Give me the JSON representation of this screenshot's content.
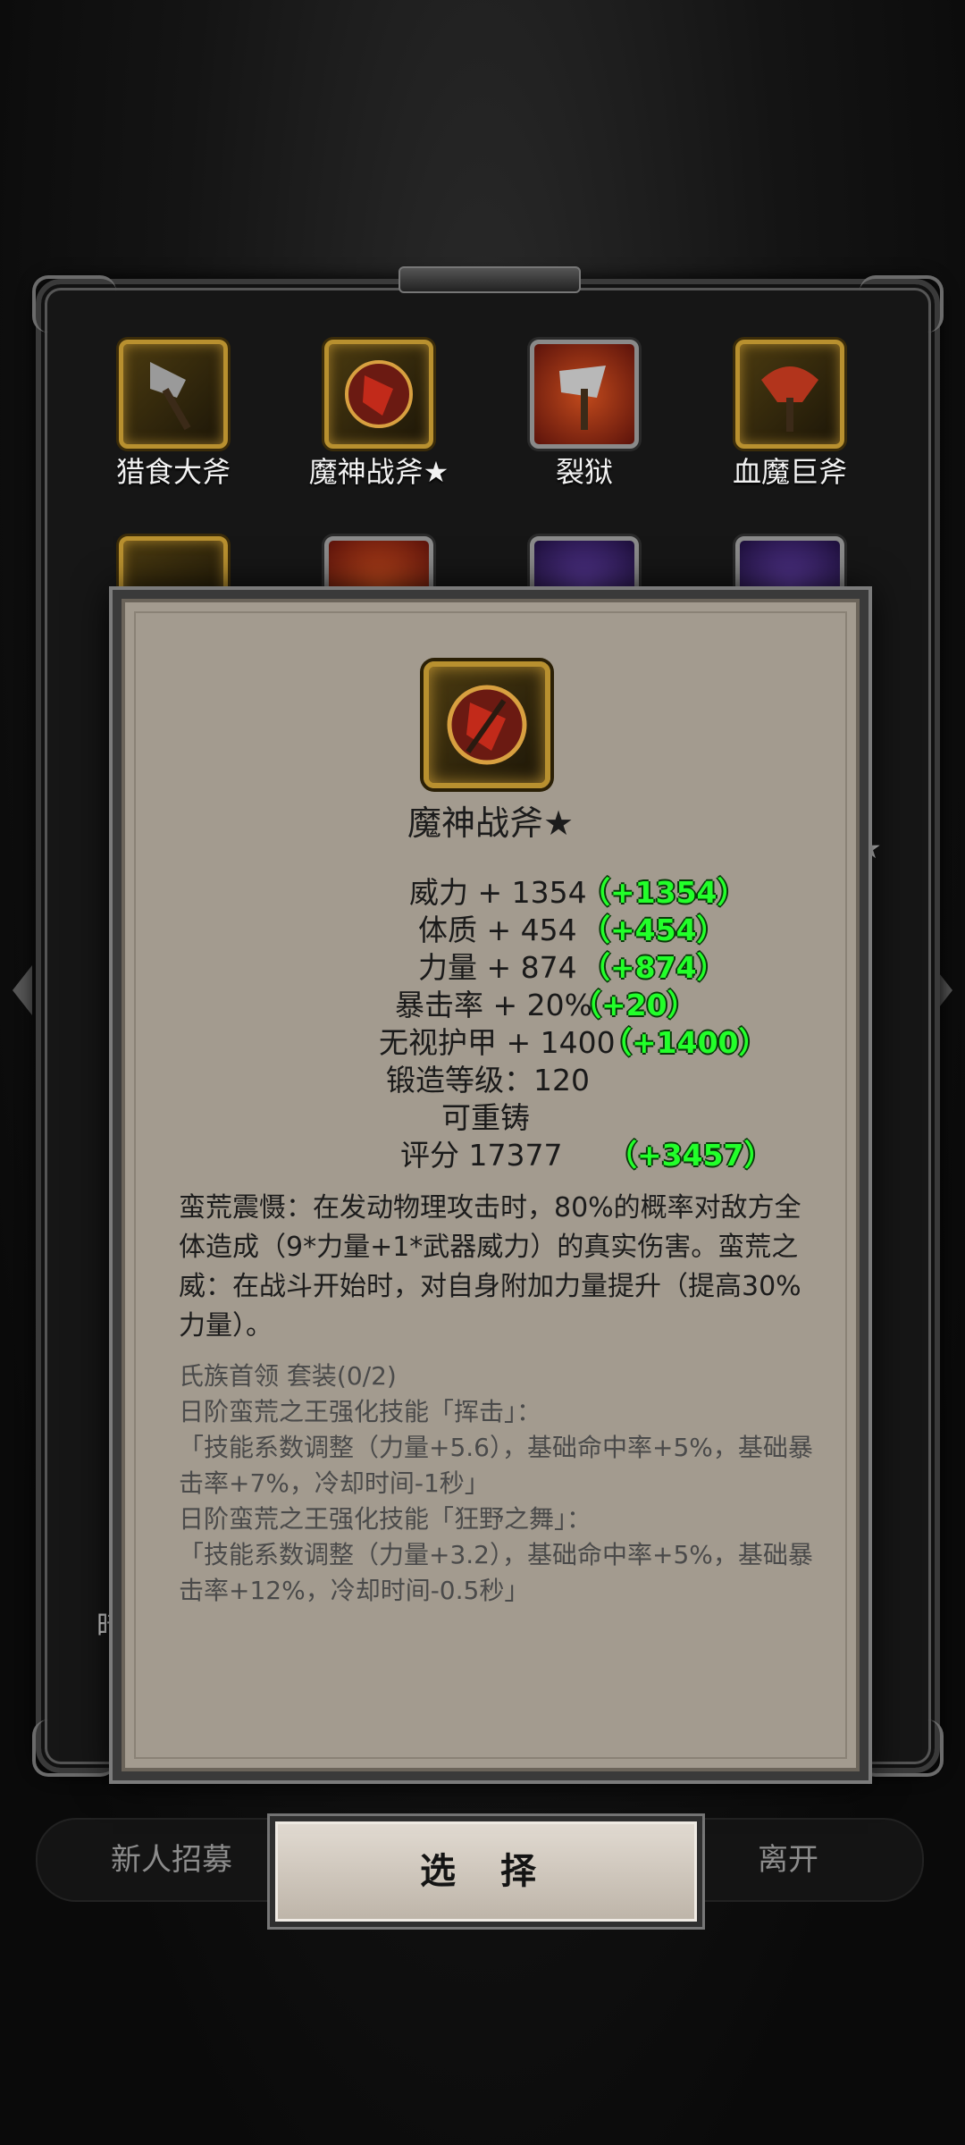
{
  "weapons_row1": [
    {
      "label": "猎食大斧",
      "icon": "axe-icon"
    },
    {
      "label": "魔神战斧★",
      "icon": "demon-axe-icon"
    },
    {
      "label": "裂狱",
      "icon": "cleaver-axe-icon"
    },
    {
      "label": "血魔巨斧",
      "icon": "blood-axe-icon"
    }
  ],
  "behind": {
    "star": "★",
    "fragment": "暗"
  },
  "buttons": {
    "recruit": "新人招募",
    "select": "选 择",
    "leave": "离开"
  },
  "detail": {
    "name": "魔神战斧★",
    "stats": [
      {
        "text": "威力 + 1354",
        "bonus": "（+1354）"
      },
      {
        "text": "体质 + 454",
        "bonus": "（+454）"
      },
      {
        "text": "力量 + 874",
        "bonus": "（+874）"
      },
      {
        "text": "暴击率 + 20%",
        "bonus": "（+20）"
      },
      {
        "text": "无视护甲 + 1400",
        "bonus": "（+1400）"
      }
    ],
    "forge_level": "锻造等级：120",
    "reforge": "可重铸",
    "score": "评分 17377",
    "score_bonus": "（+3457）",
    "description": "蛮荒震慑：在发动物理攻击时，80%的概率对敌方全体造成（9*力量+1*武器威力）的真实伤害。蛮荒之威：在战斗开始时，对自身附加力量提升（提高30%力量）。",
    "set_title": "氏族首领 套装(0/2)",
    "set_lines": [
      "日阶蛮荒之王强化技能「挥击」：",
      "「技能系数调整（力量+5.6），基础命中率+5%，基础暴击率+7%，冷却时间-1秒」",
      "日阶蛮荒之王强化技能「狂野之舞」：",
      "「技能系数调整（力量+3.2），基础命中率+5%，基础暴击率+12%，冷却时间-0.5秒」"
    ]
  }
}
